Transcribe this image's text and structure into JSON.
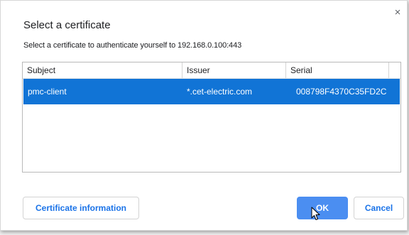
{
  "dialog": {
    "title": "Select a certificate",
    "subtitle": "Select a certificate to authenticate yourself to 192.168.0.100:443",
    "close_label": "×"
  },
  "table": {
    "columns": [
      "Subject",
      "Issuer",
      "Serial"
    ],
    "rows": [
      {
        "subject": "pmc-client",
        "issuer": "*.cet-electric.com",
        "serial": "008798F4370C35FD2C",
        "selected": true
      }
    ]
  },
  "buttons": {
    "certificate_info": "Certificate information",
    "ok": "OK",
    "cancel": "Cancel"
  },
  "colors": {
    "selection": "#1174d6",
    "primary_button": "#4b8ef1",
    "link_text": "#1a73e8"
  },
  "icons": {
    "close": "close-icon",
    "cursor": "mouse-pointer-icon"
  }
}
